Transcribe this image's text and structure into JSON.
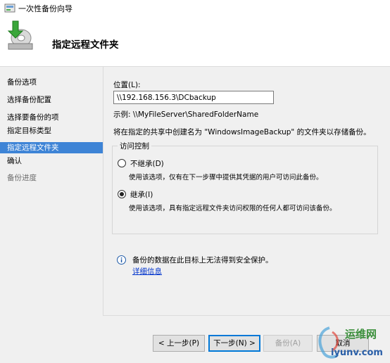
{
  "window": {
    "title": "一次性备份向导"
  },
  "header": {
    "heading": "指定远程文件夹"
  },
  "sidebar": {
    "items": [
      {
        "label": "备份选项",
        "state": "normal"
      },
      {
        "label": "选择备份配置",
        "state": "normal"
      },
      {
        "label": "选择要备份的项",
        "state": "normal"
      },
      {
        "label": "指定目标类型",
        "state": "normal"
      },
      {
        "label": "指定远程文件夹",
        "state": "selected"
      },
      {
        "label": "确认",
        "state": "normal"
      },
      {
        "label": "备份进度",
        "state": "disabled"
      }
    ]
  },
  "main": {
    "location_label": "位置(L):",
    "location_value": "\\\\192.168.156.3\\DCbackup",
    "example": "示例: \\\\MyFileServer\\SharedFolderName",
    "note": "将在指定的共享中创建名为 \"WindowsImageBackup\" 的文件夹以存储备份。",
    "access": {
      "legend": "访问控制",
      "options": [
        {
          "label": "不继承(D)",
          "description": "使用该选项，仅有在下一步骤中提供其凭据的用户可访问此备份。",
          "checked": false
        },
        {
          "label": "继承(I)",
          "description": "使用该选项，具有指定远程文件夹访问权限的任何人都可访问该备份。",
          "checked": true
        }
      ]
    },
    "security_note": "备份的数据在此目标上无法得到安全保护。",
    "details_link": "详细信息"
  },
  "footer": {
    "prev_button": "< 上一步(P)",
    "next_button": "下一步(N) >",
    "backup_button": "备份(A)",
    "cancel_button": "取消"
  },
  "watermark": {
    "logo_text": "运维网",
    "url": "iyunv.com"
  },
  "colors": {
    "selection": "#3e84d6",
    "link": "#0033cc",
    "panel": "#f0f0f0"
  }
}
